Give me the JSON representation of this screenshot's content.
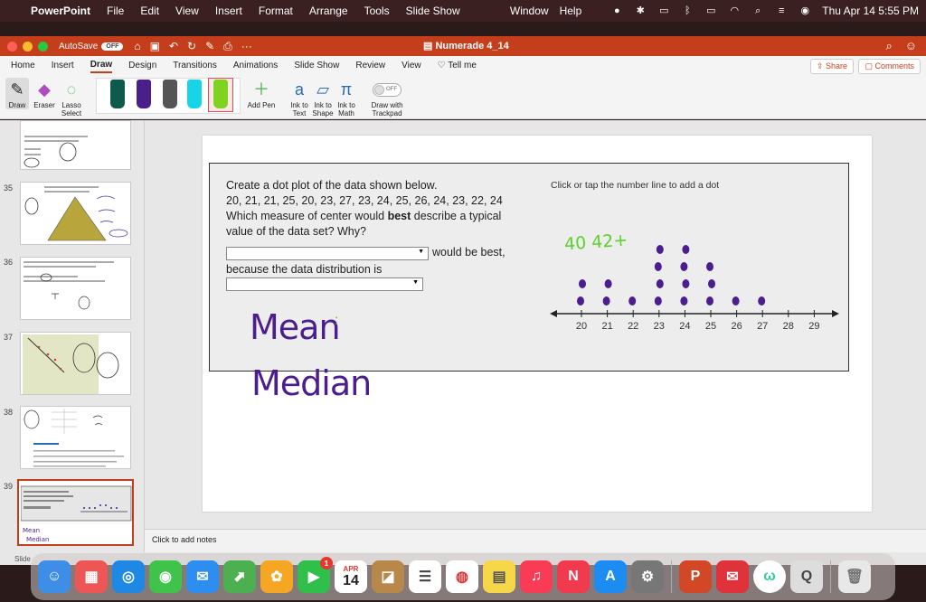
{
  "menubar": {
    "app_name": "PowerPoint",
    "items": [
      "File",
      "Edit",
      "View",
      "Insert",
      "Format",
      "Arrange",
      "Tools",
      "Slide Show"
    ],
    "right_items": [
      "Window",
      "Help"
    ],
    "clock": "Thu Apr 14  5:55 PM"
  },
  "titlebar": {
    "autosave_label": "AutoSave",
    "autosave_state": "OFF",
    "document_title": "Numerade 4_14"
  },
  "tabs": [
    "Home",
    "Insert",
    "Draw",
    "Design",
    "Transitions",
    "Animations",
    "Slide Show",
    "Review",
    "View"
  ],
  "tell_me": "Tell me",
  "active_tab": "Draw",
  "share_label": "Share",
  "comments_label": "Comments",
  "ribbon": {
    "draw_label": "Draw",
    "eraser_label": "Eraser",
    "lasso_label": "Lasso Select",
    "add_pen_label": "Add Pen",
    "ink_to_text": "Ink to Text",
    "ink_to_shape": "Ink to Shape",
    "ink_to_math": "Ink to Math",
    "draw_trackpad": "Draw with Trackpad",
    "trackpad_toggle": "OFF"
  },
  "pens": [
    {
      "color": "#0e5a4c",
      "name": "dark-teal-pen"
    },
    {
      "color": "#4a1f8a",
      "name": "purple-pen"
    },
    {
      "color": "#555555",
      "name": "gray-pen"
    },
    {
      "color": "#17d5e8",
      "name": "cyan-highlighter"
    },
    {
      "color": "#7ed321",
      "name": "green-highlighter"
    }
  ],
  "thumbnails": [
    "35",
    "36",
    "37",
    "38",
    "39"
  ],
  "slide": {
    "question_line1": "Create a dot plot of the data shown below.",
    "data_values": "20, 21, 21, 25, 20, 23, 27, 23, 24, 25, 26, 24, 23, 22, 24",
    "question_line3_pre": "Which measure of center would ",
    "question_line3_bold": "best",
    "question_line3_post": " describe a typical",
    "question_line4": "value of the data set? Why?",
    "would_be_best": "would be best,",
    "because_text": "because the data distribution is",
    "instruction": "Click or tap the number line to add a dot",
    "handwritten_green": "40 42+",
    "handwritten_mean": "Mean",
    "handwritten_median": "Median"
  },
  "number_line": {
    "ticks": [
      "20",
      "21",
      "22",
      "23",
      "24",
      "25",
      "26",
      "27",
      "28",
      "29"
    ],
    "dot_counts": [
      2,
      2,
      1,
      4,
      4,
      3,
      1,
      1,
      0,
      0
    ]
  },
  "notes_placeholder": "Click to add notes",
  "status_left": "Slide",
  "dock": {
    "calendar_month": "APR",
    "calendar_day": "14",
    "facetime_badge": "1"
  },
  "colors": {
    "accent": "#c43e1c",
    "ink_purple": "#4b1d8f",
    "ink_green": "#5fd12b"
  }
}
